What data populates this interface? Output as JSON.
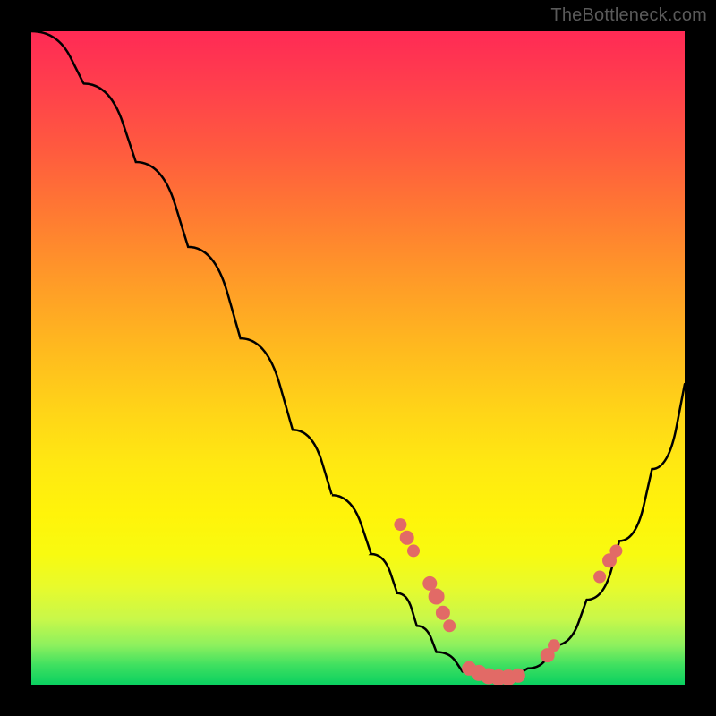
{
  "watermark": "TheBottleneck.com",
  "colors": {
    "marker": "#e26a66",
    "curve": "#000000"
  },
  "chart_data": {
    "type": "line",
    "title": "",
    "xlabel": "",
    "ylabel": "",
    "xlim": [
      0,
      1
    ],
    "ylim": [
      0,
      1
    ],
    "curve_points": [
      {
        "x": 0.0,
        "y": 1.0
      },
      {
        "x": 0.08,
        "y": 0.92
      },
      {
        "x": 0.16,
        "y": 0.8
      },
      {
        "x": 0.24,
        "y": 0.67
      },
      {
        "x": 0.32,
        "y": 0.53
      },
      {
        "x": 0.4,
        "y": 0.39
      },
      {
        "x": 0.46,
        "y": 0.29
      },
      {
        "x": 0.52,
        "y": 0.2
      },
      {
        "x": 0.56,
        "y": 0.14
      },
      {
        "x": 0.59,
        "y": 0.09
      },
      {
        "x": 0.62,
        "y": 0.05
      },
      {
        "x": 0.66,
        "y": 0.02
      },
      {
        "x": 0.71,
        "y": 0.01
      },
      {
        "x": 0.76,
        "y": 0.025
      },
      {
        "x": 0.8,
        "y": 0.06
      },
      {
        "x": 0.85,
        "y": 0.13
      },
      {
        "x": 0.9,
        "y": 0.22
      },
      {
        "x": 0.95,
        "y": 0.33
      },
      {
        "x": 1.0,
        "y": 0.46
      }
    ],
    "markers": [
      {
        "x": 0.565,
        "y": 0.245,
        "r": 7
      },
      {
        "x": 0.575,
        "y": 0.225,
        "r": 8
      },
      {
        "x": 0.585,
        "y": 0.205,
        "r": 7
      },
      {
        "x": 0.61,
        "y": 0.155,
        "r": 8
      },
      {
        "x": 0.62,
        "y": 0.135,
        "r": 9
      },
      {
        "x": 0.63,
        "y": 0.11,
        "r": 8
      },
      {
        "x": 0.64,
        "y": 0.09,
        "r": 7
      },
      {
        "x": 0.67,
        "y": 0.025,
        "r": 8
      },
      {
        "x": 0.685,
        "y": 0.018,
        "r": 9
      },
      {
        "x": 0.7,
        "y": 0.013,
        "r": 9
      },
      {
        "x": 0.715,
        "y": 0.011,
        "r": 9
      },
      {
        "x": 0.73,
        "y": 0.011,
        "r": 9
      },
      {
        "x": 0.745,
        "y": 0.014,
        "r": 8
      },
      {
        "x": 0.79,
        "y": 0.045,
        "r": 8
      },
      {
        "x": 0.8,
        "y": 0.06,
        "r": 7
      },
      {
        "x": 0.87,
        "y": 0.165,
        "r": 7
      },
      {
        "x": 0.885,
        "y": 0.19,
        "r": 8
      },
      {
        "x": 0.895,
        "y": 0.205,
        "r": 7
      }
    ]
  }
}
